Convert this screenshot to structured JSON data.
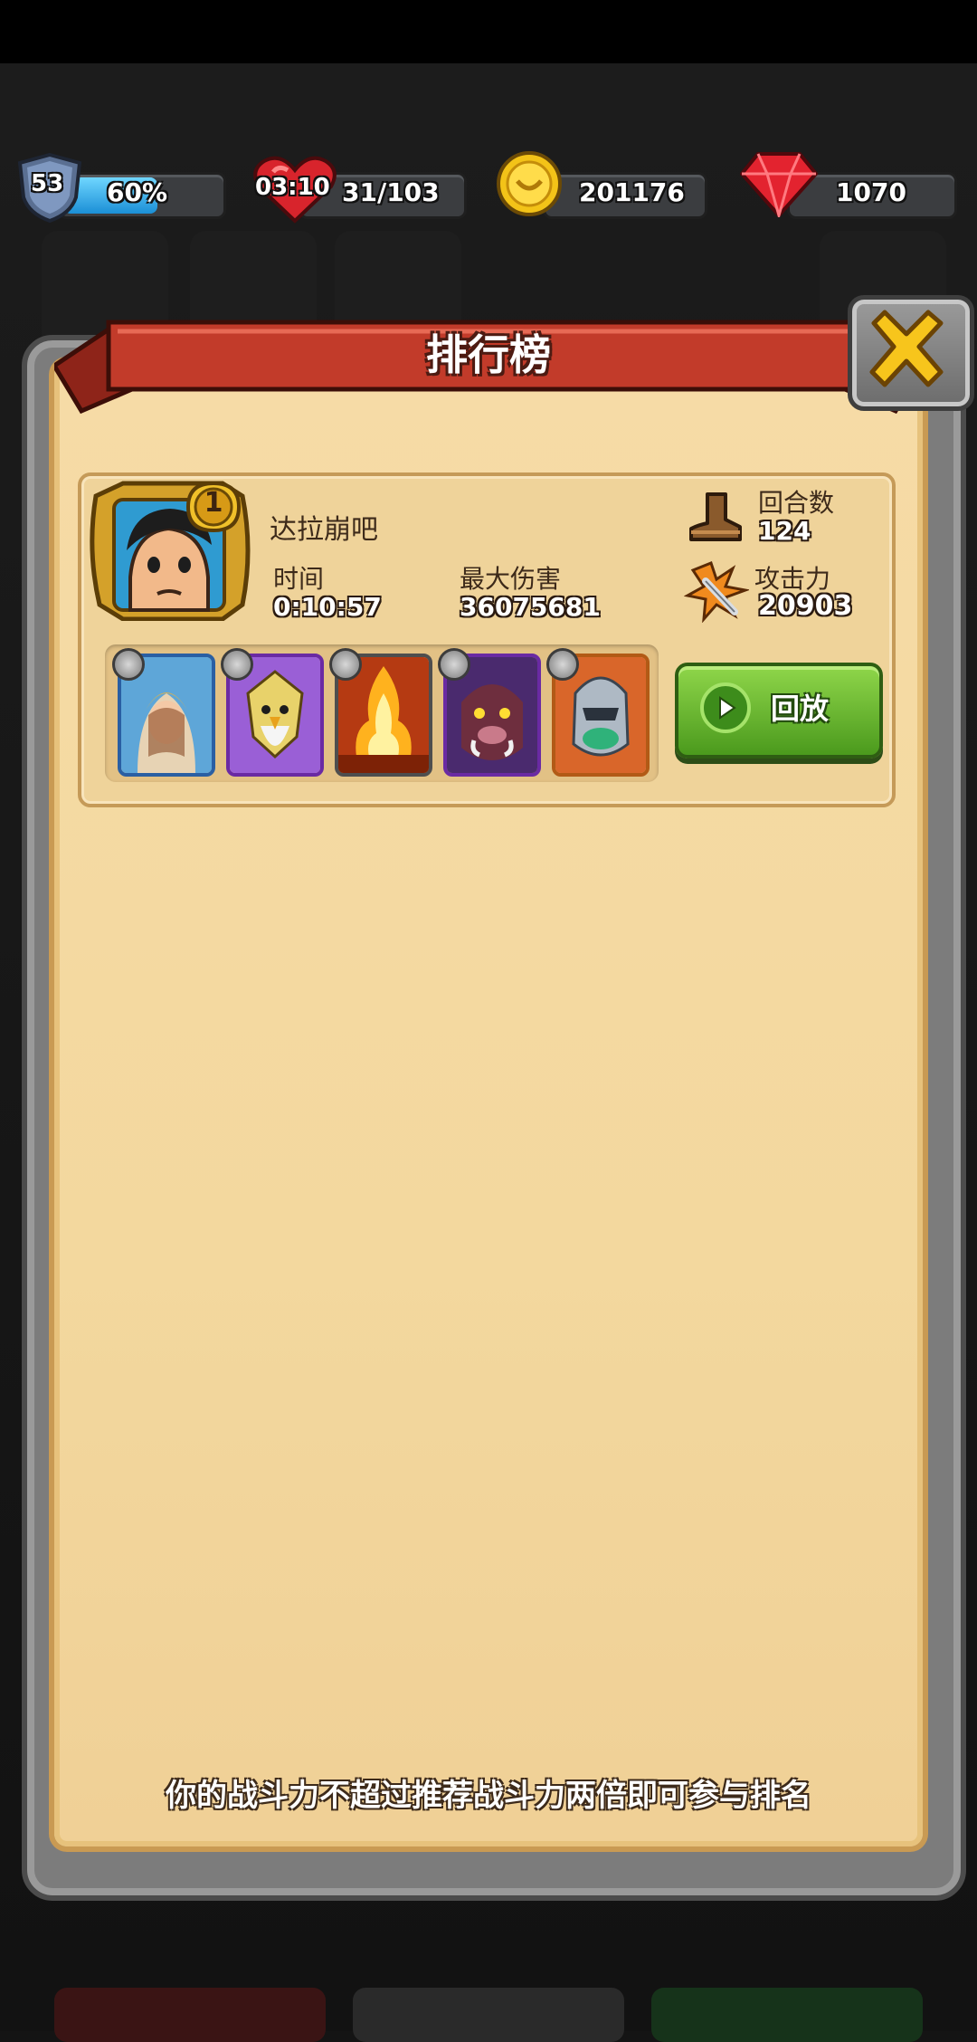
{
  "hud": {
    "level": "53",
    "xp_percent": "60%",
    "xp_fraction": 0.6,
    "stamina_timer": "03:10",
    "stamina": "31/103",
    "gold": "201176",
    "gems": "1070"
  },
  "panel": {
    "title": "排行榜"
  },
  "entry": {
    "rank": "1",
    "player_name": "达拉崩吧",
    "time_label": "时间",
    "time_value": "0:10:57",
    "damage_label": "最大伤害",
    "damage_value": "36075681",
    "rounds_label": "回合数",
    "rounds_value": "124",
    "attack_label": "攻击力",
    "attack_value": "20903",
    "replay_label": "回放",
    "heroes": [
      {
        "name": "priestess-hero",
        "color": "#3d86c9"
      },
      {
        "name": "eagle-warrior-hero",
        "color": "#8a3ec9"
      },
      {
        "name": "fire-spirit-hero",
        "color": "#8c8c8c"
      },
      {
        "name": "boar-warlord-hero",
        "color": "#8a3ec9"
      },
      {
        "name": "steel-knight-hero",
        "color": "#d27a2d"
      }
    ]
  },
  "notice": "你的战斗力不超过推荐战斗力两倍即可参与排名",
  "colors": {
    "ribbon": "#c23b2a",
    "parchment": "#f3d89e",
    "replay_green": "#5fae2a"
  }
}
